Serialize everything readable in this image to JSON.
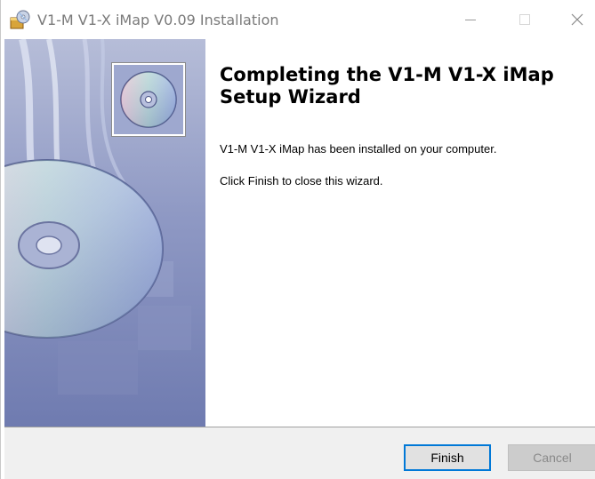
{
  "window": {
    "title": "V1-M V1-X iMap V0.09 Installation",
    "icon": "installer-icon",
    "controls": [
      "minimize-icon",
      "maximize-icon",
      "close-icon"
    ]
  },
  "banner": {
    "image": "cd-disc-banner",
    "thumbnail": "cd-disc-icon"
  },
  "content": {
    "heading": "Completing the V1-M V1-X iMap Setup Wizard",
    "installed_message": "V1-M V1-X iMap has been installed on your computer.",
    "close_instruction": "Click Finish to close this wizard."
  },
  "buttons": {
    "finish_label": "Finish",
    "cancel_label": "Cancel"
  },
  "colors": {
    "accent": "#0078d7",
    "footer_bg": "#f0f0f0",
    "banner": "#8f99c4"
  }
}
